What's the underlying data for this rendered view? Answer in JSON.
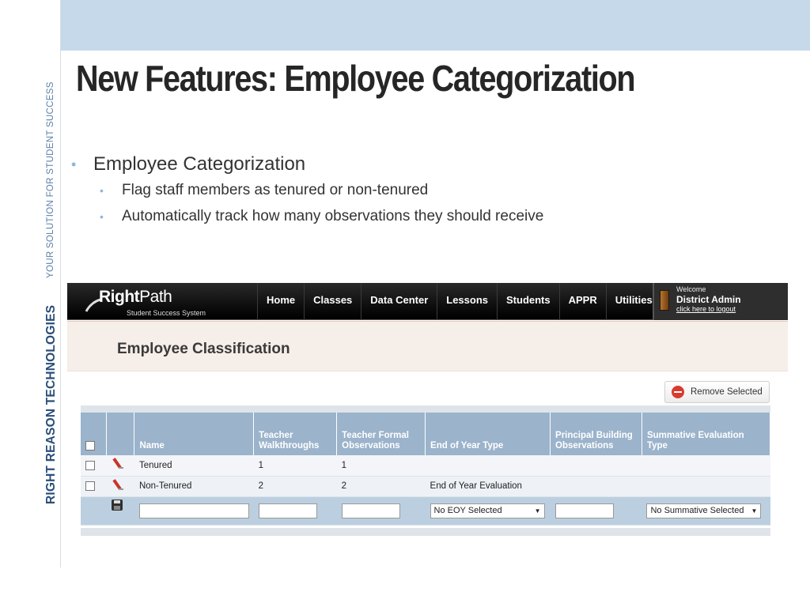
{
  "slide": {
    "title": "New Features: Employee Categorization",
    "side_main": "RIGHT REASON TECHNOLOGIES",
    "side_sub": "YOUR SOLUTION FOR STUDENT SUCCESS",
    "bullet_main": "Employee Categorization",
    "bullet_sub": [
      "Flag staff members as tenured or non-tenured",
      "Automatically track how many observations they should receive"
    ]
  },
  "app": {
    "logo": {
      "bold": "Right",
      "thin": "Path",
      "tagline": "Student Success System"
    },
    "nav": [
      "Home",
      "Classes",
      "Data Center",
      "Lessons",
      "Students",
      "APPR",
      "Utilities"
    ],
    "user": {
      "welcome": "Welcome",
      "name": "District Admin",
      "logout": "click here to logout"
    },
    "page_title": "Employee Classification",
    "remove_button": "Remove Selected",
    "table": {
      "columns": [
        "Name",
        "Teacher Walkthroughs",
        "Teacher Formal Observations",
        "End of Year Type",
        "Principal Building Observations",
        "Summative Evaluation Type"
      ],
      "rows": [
        {
          "name": "Tenured",
          "walkthroughs": "1",
          "formal": "1",
          "eoy": "",
          "principal": "",
          "summative": ""
        },
        {
          "name": "Non-Tenured",
          "walkthroughs": "2",
          "formal": "2",
          "eoy": "End of Year Evaluation",
          "principal": "",
          "summative": ""
        }
      ],
      "new_row": {
        "eoy_select": "No EOY Selected",
        "summative_select": "No Summative Selected"
      }
    }
  }
}
